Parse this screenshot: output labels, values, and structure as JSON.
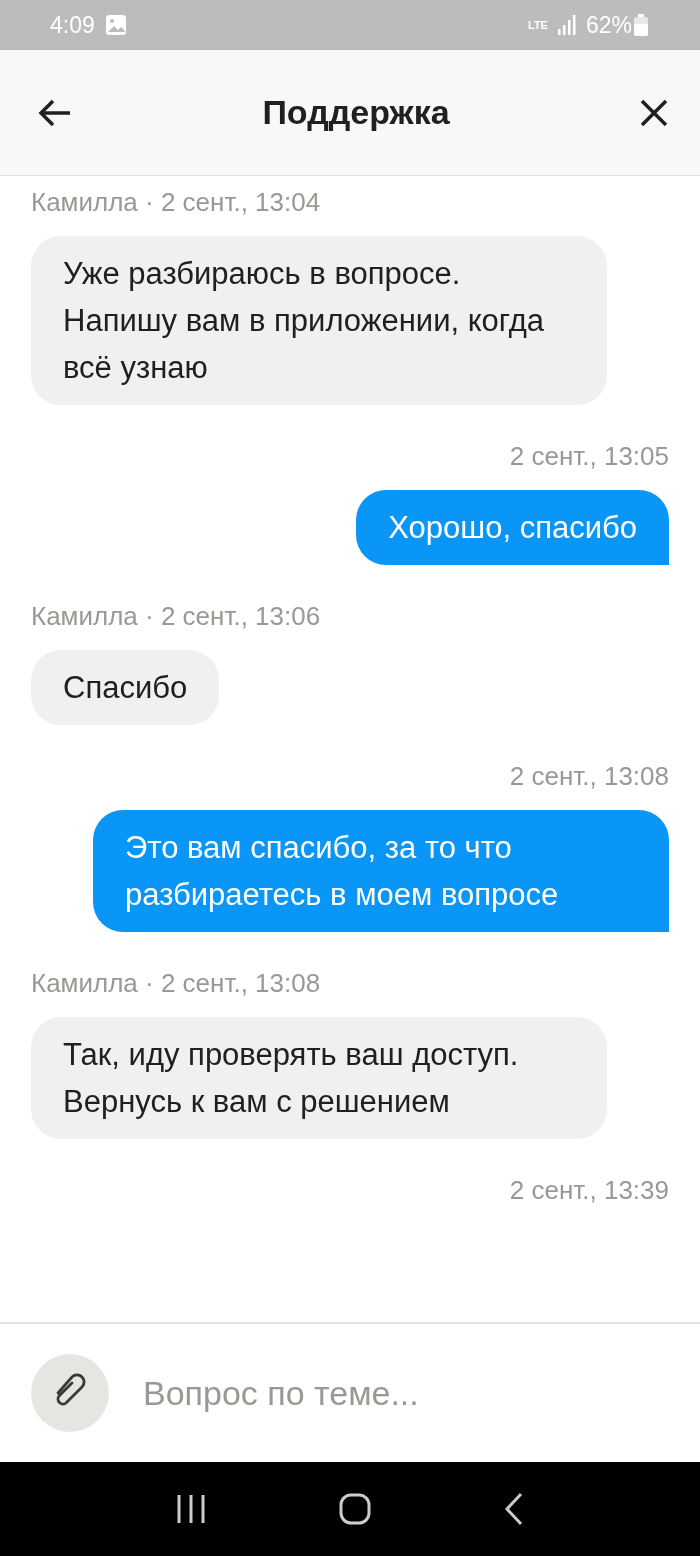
{
  "status_bar": {
    "time": "4:09",
    "network": "LTE",
    "battery": "62%"
  },
  "header": {
    "title": "Поддержка"
  },
  "messages": [
    {
      "kind": "incoming",
      "meta": "Камилла · 2 сент., 13:04",
      "text": "Уже разбираюсь в вопросе. Напишу вам в приложении, когда всё узнаю"
    },
    {
      "kind": "outgoing",
      "meta": "2 сент., 13:05",
      "text": "Хорошо, спасибо"
    },
    {
      "kind": "incoming",
      "meta": "Камилла · 2 сент., 13:06",
      "text": "Спасибо"
    },
    {
      "kind": "outgoing",
      "meta": "2 сент., 13:08",
      "text": "Это вам спасибо, за то что разбираетесь в моем вопросе"
    },
    {
      "kind": "incoming",
      "meta": "Камилла · 2 сент., 13:08",
      "text": "Так, иду проверять ваш доступ. Вернусь к вам с решением"
    },
    {
      "kind": "outgoing",
      "meta": "2 сент., 13:39"
    }
  ],
  "composer": {
    "placeholder": "Вопрос по теме..."
  }
}
